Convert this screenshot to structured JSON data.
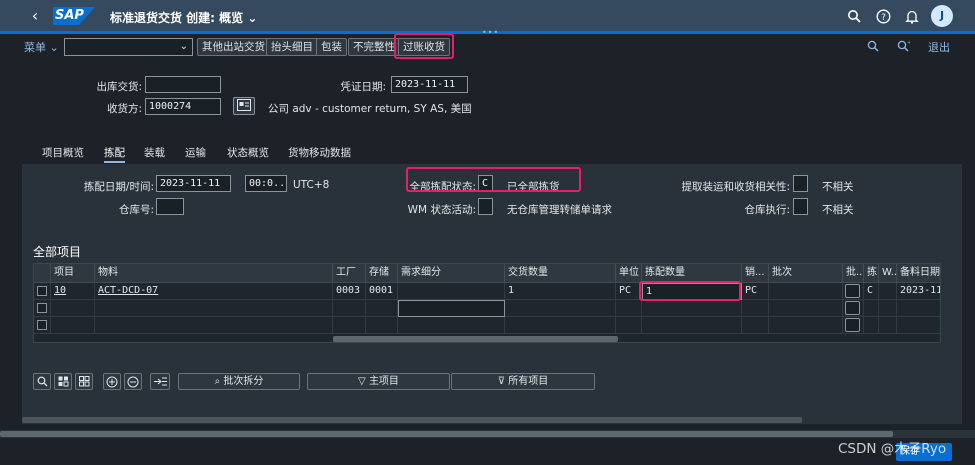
{
  "shell": {
    "title": "标准退货交货 创建: 概览",
    "logo": "SAP",
    "avatar": "J"
  },
  "toolbar": {
    "menu": "菜单",
    "buttons": [
      "其他出站交货",
      "抬头细目",
      "包装",
      "不完整性",
      "过账收货"
    ],
    "exit": "退出"
  },
  "header": {
    "outbound_delivery_label": "出库交货:",
    "outbound_delivery_value": "",
    "doc_date_label": "凭证日期:",
    "doc_date_value": "2023-11-11",
    "receiving_party_label": "收货方:",
    "receiving_party_value": "1000274",
    "receiving_party_desc": "公司 adv - customer return, SY AS, 美国"
  },
  "tabs": [
    "项目概览",
    "拣配",
    "装载",
    "运输",
    "状态概览",
    "货物移动数据"
  ],
  "picking": {
    "pick_date_label": "拣配日期/时间:",
    "pick_date": "2023-11-11",
    "pick_time": "00:0...",
    "timezone": "UTC+8",
    "warehouse_label": "仓库号:",
    "overall_status_label": "全部拣配状态:",
    "overall_status_code": "C",
    "overall_status_text": "已全部拣货",
    "wm_label": "WM 状态活动:",
    "wm_text": "无仓库管理转储单请求",
    "relevance_label": "提取装运和收货相关性:",
    "relevance_text": "不相关",
    "warehouse_exec_label": "仓库执行:",
    "warehouse_exec_text": "不相关"
  },
  "items": {
    "section_title": "全部项目",
    "columns": [
      "项目",
      "物料",
      "工厂",
      "存储",
      "需求细分",
      "交货数量",
      "单位",
      "拣配数量",
      "销...",
      "批次",
      "批...",
      "拣...",
      "W...",
      "备料日期"
    ],
    "rows": [
      [
        "10",
        "ACT-DCD-07",
        "0003",
        "0001",
        "",
        "1",
        "PC",
        "1",
        "PC",
        "",
        "",
        "C",
        "",
        "2023-11"
      ]
    ]
  },
  "bottom": {
    "batch_split": "批次拆分",
    "main_items": "主项目",
    "all_items": "所有项目"
  },
  "footer": {
    "save": "保存",
    "watermark": "CSDN @木子Ryo"
  },
  "colors": {
    "shell": "#354a5f",
    "accent": "#0a6ed1",
    "highlight": "#e5206b",
    "background": "#1c2228"
  }
}
